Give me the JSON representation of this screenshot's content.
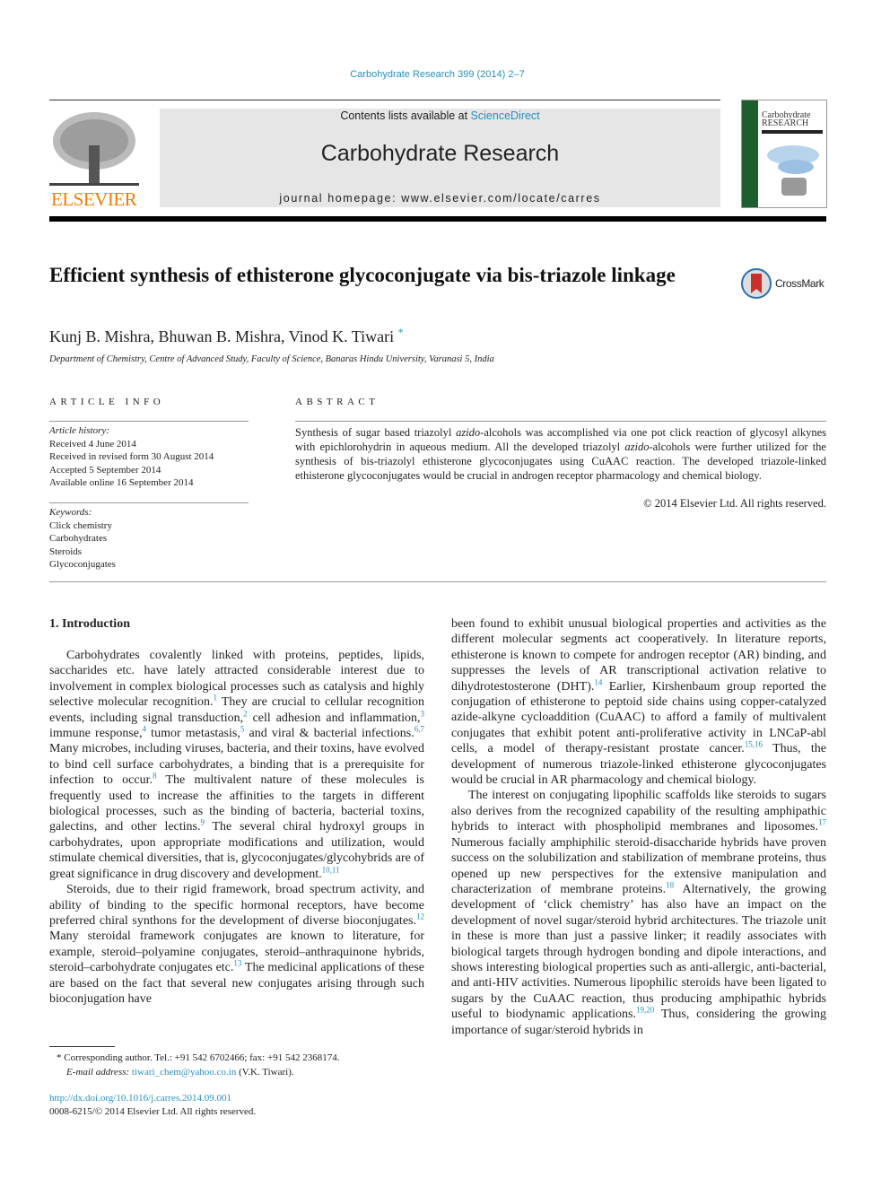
{
  "header": {
    "journal_ref": "Carbohydrate Research 399 (2014) 2–7",
    "contents_prefix": "Contents lists available at ",
    "sciencedirect": "ScienceDirect",
    "journal_title": "Carbohydrate Research",
    "homepage": "journal homepage: www.elsevier.com/locate/carres",
    "publisher_logo": "ELSEVIER",
    "cover_title_1": "Carbohydrate",
    "cover_title_2": "RESEARCH",
    "colors": {
      "link": "#2a8fc0",
      "elsevier": "#f07d00",
      "cover_green": "#1e5e2e"
    }
  },
  "article": {
    "title": "Efficient synthesis of ethisterone glycoconjugate via bis-triazole linkage",
    "crossmark": "CrossMark",
    "authors": "Kunj B. Mishra, Bhuwan B. Mishra, Vinod K. Tiwari",
    "author_mark": "*",
    "affiliation": "Department of Chemistry, Centre of Advanced Study, Faculty of Science, Banaras Hindu University, Varanasi 5, India"
  },
  "info": {
    "heading": "ARTICLE INFO",
    "history_label": "Article history:",
    "history": [
      "Received 4 June 2014",
      "Received in revised form 30 August 2014",
      "Accepted 5 September 2014",
      "Available online 16 September 2014"
    ],
    "keywords_label": "Keywords:",
    "keywords": [
      "Click chemistry",
      "Carbohydrates",
      "Steroids",
      "Glycoconjugates"
    ]
  },
  "abstract": {
    "heading": "ABSTRACT",
    "segments": [
      {
        "t": "Synthesis of sugar based triazolyl "
      },
      {
        "i": "azido"
      },
      {
        "t": "-alcohols was accomplished via one pot click reaction of glycosyl alkynes with epichlorohydrin in aqueous medium. All the developed triazolyl "
      },
      {
        "i": "azido"
      },
      {
        "t": "-alcohols were further utilized for the synthesis of bis-triazolyl ethisterone glycoconjugates using CuAAC reaction. The developed triazole-linked ethisterone glycoconjugates would be crucial in androgen receptor pharmacology and chemical biology."
      }
    ],
    "copyright": "© 2014 Elsevier Ltd. All rights reserved."
  },
  "intro": {
    "heading": "1. Introduction",
    "left": [
      [
        {
          "t": "Carbohydrates covalently linked with proteins, peptides, lipids, saccharides etc. have lately attracted considerable interest due to involvement in complex biological processes such as catalysis and highly selective molecular recognition."
        },
        {
          "r": "1"
        },
        {
          "t": " They are crucial to cellular recognition events, including signal transduction,"
        },
        {
          "r": "2"
        },
        {
          "t": " cell adhesion and inflammation,"
        },
        {
          "r": "3"
        },
        {
          "t": " immune response,"
        },
        {
          "r": "4"
        },
        {
          "t": " tumor metastasis,"
        },
        {
          "r": "5"
        },
        {
          "t": " and viral & bacterial infections."
        },
        {
          "r": "6,7"
        },
        {
          "t": " Many microbes, including viruses, bacteria, and their toxins, have evolved to bind cell surface carbohydrates, a binding that is a prerequisite for infection to occur."
        },
        {
          "r": "8"
        },
        {
          "t": " The multivalent nature of these molecules is frequently used to increase the affinities to the targets in different biological processes, such as the binding of bacteria, bacterial toxins, galectins, and other lectins."
        },
        {
          "r": "9"
        },
        {
          "t": " The several chiral hydroxyl groups in carbohydrates, upon appropriate modifications and utilization, would stimulate chemical diversities, that is, glycoconjugates/glycohybrids are of great significance in drug discovery and development."
        },
        {
          "r": "10,11"
        }
      ],
      [
        {
          "t": "Steroids, due to their rigid framework, broad spectrum activity, and ability of binding to the specific hormonal receptors, have become preferred chiral synthons for the development of diverse bioconjugates."
        },
        {
          "r": "12"
        },
        {
          "t": " Many steroidal framework conjugates are known to literature, for example, steroid–polyamine conjugates, steroid–anthraquinone hybrids, steroid–carbohydrate conjugates etc."
        },
        {
          "r": "13"
        },
        {
          "t": " The medicinal applications of these are based on the fact that several new conjugates arising through such bioconjugation have"
        }
      ]
    ],
    "right": [
      [
        {
          "t": "been found to exhibit unusual biological properties and activities as the different molecular segments act cooperatively. In literature reports, ethisterone is known to compete for androgen receptor (AR) binding, and suppresses the levels of AR transcriptional activation relative to dihydrotestosterone (DHT)."
        },
        {
          "r": "14"
        },
        {
          "t": " Earlier, Kirshenbaum group reported the conjugation of ethisterone to peptoid side chains using copper-catalyzed azide-alkyne cycloaddition (CuAAC) to afford a family of multivalent conjugates that exhibit potent anti-proliferative activity in LNCaP-abl cells, a model of therapy-resistant prostate cancer."
        },
        {
          "r": "15,16"
        },
        {
          "t": " Thus, the development of numerous triazole-linked ethisterone glycoconjugates would be crucial in AR pharmacology and chemical biology."
        }
      ],
      [
        {
          "t": "The interest on conjugating lipophilic scaffolds like steroids to sugars also derives from the recognized capability of the resulting amphipathic hybrids to interact with phospholipid membranes and liposomes."
        },
        {
          "r": "17"
        },
        {
          "t": " Numerous facially amphiphilic steroid-disaccharide hybrids have proven success on the solubilization and stabilization of membrane proteins, thus opened up new perspectives for the extensive manipulation and characterization of membrane proteins."
        },
        {
          "r": "18"
        },
        {
          "t": " Alternatively, the growing development of ‘click chemistry’ has also have an impact on the development of novel sugar/steroid hybrid architectures. The triazole unit in these is more than just a passive linker; it readily associates with biological targets through hydrogen bonding and dipole interactions, and shows interesting biological properties such as anti-allergic, anti-bacterial, and anti-HIV activities. Numerous lipophilic steroids have been ligated to sugars by the CuAAC reaction, thus producing amphipathic hybrids useful to biodynamic applications."
        },
        {
          "r": "19,20"
        },
        {
          "t": " Thus, considering the growing importance of sugar/steroid hybrids in"
        }
      ]
    ]
  },
  "footnote": {
    "mark": "*",
    "text": " Corresponding author. Tel.: +91 542 6702466; fax: +91 542 2368174.",
    "email_label": "E-mail address: ",
    "email": "tiwari_chem@yahoo.co.in",
    "email_suffix": " (V.K. Tiwari)."
  },
  "doi": {
    "link": "http://dx.doi.org/10.1016/j.carres.2014.09.001",
    "rights": "0008-6215/© 2014 Elsevier Ltd. All rights reserved."
  }
}
